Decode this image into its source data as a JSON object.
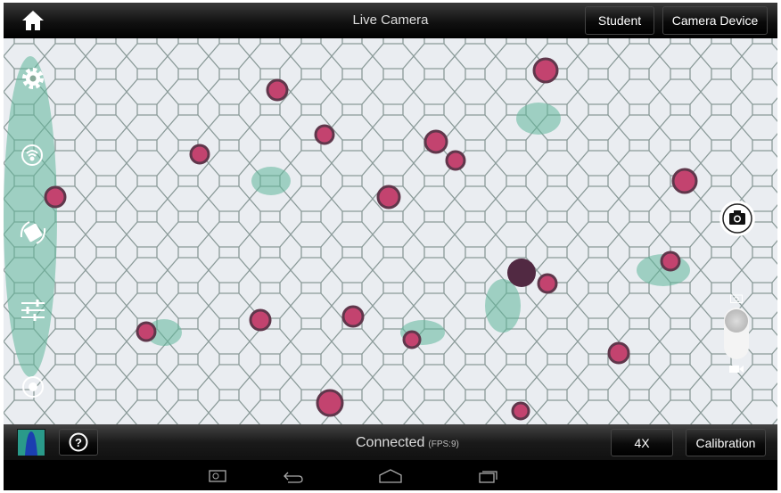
{
  "header": {
    "title": "Live Camera",
    "student_label": "Student",
    "camera_device_label": "Camera Device"
  },
  "footer": {
    "status": "Connected",
    "fps": "(FPS:9)",
    "magnification_label": "4X",
    "calibration_label": "Calibration"
  },
  "left_tools": [
    "gear-icon",
    "wifi-icon",
    "rotate-icon",
    "sliders-icon",
    "target-icon"
  ],
  "right_tools": [
    "capture-photo-icon",
    "photo-video-toggle"
  ],
  "capture_mode": "photo",
  "colors": {
    "accent": "#ffffff",
    "bar": "#000000",
    "stain_red": "#b0204a",
    "stain_green": "#4aa88a"
  }
}
